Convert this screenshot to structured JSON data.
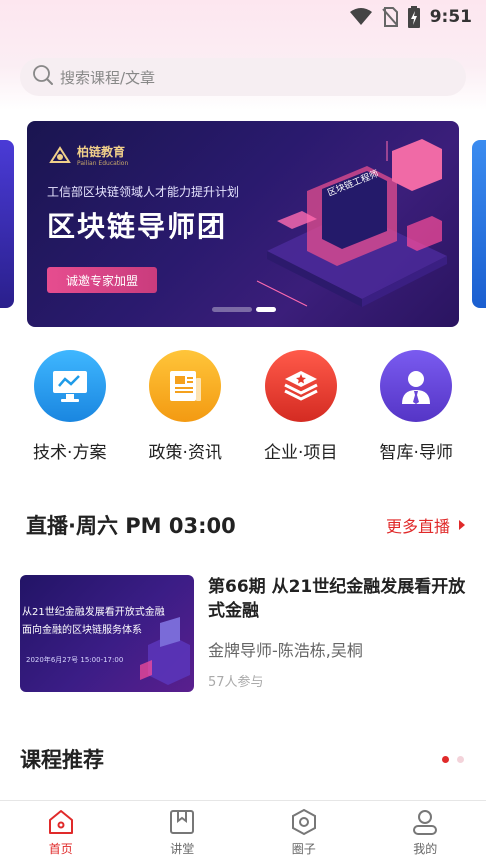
{
  "status_bar": {
    "time": "9:51"
  },
  "search": {
    "placeholder": "搜索课程/文章"
  },
  "banner": {
    "logo_text": "柏链教育",
    "logo_sub": "Pailian Education",
    "subtitle": "工信部区块链领域人才能力提升计划",
    "title": "区块链导师团",
    "cta": "诚邀专家加盟",
    "art_sign": "区块链工程师",
    "active_index": 1,
    "count": 2
  },
  "quick_menu": [
    {
      "label": "技术·方案",
      "icon": "monitor-chart-icon",
      "color": "#1e9be8"
    },
    {
      "label": "政策·资讯",
      "icon": "newspaper-icon",
      "color": "#f5a11d"
    },
    {
      "label": "企业·项目",
      "icon": "layers-star-icon",
      "color": "#e5372b"
    },
    {
      "label": "智库·导师",
      "icon": "person-tie-icon",
      "color": "#6a48d8"
    }
  ],
  "live": {
    "title": "直播·周六 PM 03:00",
    "more": "更多直播",
    "card": {
      "thumb_line1": "从21世纪金融发展看开放式金融",
      "thumb_line2": "面向金融的区块链服务体系",
      "thumb_date": "2020年6月27号 15:00-17:00",
      "title": "第66期 从21世纪金融发展看开放式金融",
      "speakers": "金牌导师-陈浩栋,吴桐",
      "participants": "57人参与"
    }
  },
  "recommend": {
    "title": "课程推荐"
  },
  "tabs": [
    {
      "label": "首页",
      "icon": "home-icon",
      "active": true
    },
    {
      "label": "讲堂",
      "icon": "bookmark-icon",
      "active": false
    },
    {
      "label": "圈子",
      "icon": "hexagon-icon",
      "active": false
    },
    {
      "label": "我的",
      "icon": "user-icon",
      "active": false
    }
  ],
  "colors": {
    "accent": "#e02a2a",
    "search_bg": "#f6eef2"
  }
}
